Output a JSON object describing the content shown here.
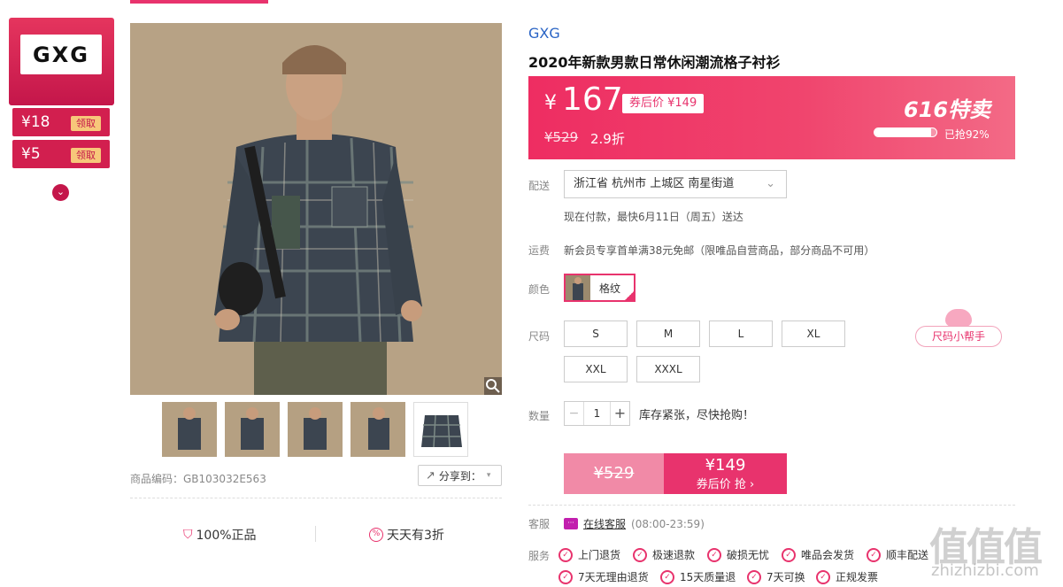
{
  "brand_panel": {
    "logo": "GXG",
    "coupons": [
      {
        "amount": "¥18",
        "action": "领取"
      },
      {
        "amount": "¥5",
        "action": "领取"
      }
    ],
    "expand_icon": "chevron-down-icon"
  },
  "product": {
    "brand": "GXG",
    "title": "2020年新款男款日常休闲潮流格子衬衫",
    "sku_code": "商品编码：GB103032E563",
    "share_label": "分享到："
  },
  "promises": [
    {
      "label": "100%正品",
      "icon": "shield-icon"
    },
    {
      "label": "天天有3折",
      "icon": "discount-icon"
    }
  ],
  "price": {
    "yen": "¥",
    "current": "167",
    "coupon_price": "券后价 ¥149",
    "original": "¥529",
    "discount": "2.9折",
    "sale_logo": "616特卖",
    "sold_percent": 92,
    "sold_text": "已抢92%"
  },
  "delivery": {
    "label": "配送",
    "address": "浙江省 杭州市 上城区 南星街道",
    "note": "现在付款，最快6月11日（周五）送达"
  },
  "shipping": {
    "label": "运费",
    "text": "新会员专享首单满38元免邮（限唯品自营商品，部分商品不可用）"
  },
  "color": {
    "label": "颜色",
    "selected": "格纹"
  },
  "size": {
    "label": "尺码",
    "options": [
      "S",
      "M",
      "L",
      "XL",
      "XXL",
      "XXXL"
    ],
    "helper": "尺码小帮手"
  },
  "quantity": {
    "label": "数量",
    "minus": "−",
    "value": "1",
    "plus": "+",
    "stock": "库存紧张，尽快抢购！"
  },
  "buy": {
    "original": "¥529",
    "price": "¥149",
    "label": "券后价 抢 ›"
  },
  "customer_service": {
    "label": "客服",
    "link": "在线客服",
    "hours": "(08:00-23:59)"
  },
  "services": {
    "label": "服务",
    "row1": [
      "上门退货",
      "极速退款",
      "破损无忧",
      "唯品会发货",
      "顺丰配送"
    ],
    "row2": [
      "7天无理由退货",
      "15天质量退",
      "7天可换",
      "正规发票"
    ]
  },
  "watermark": {
    "text": "值值值",
    "url": "zhizhizbi.com"
  },
  "colors": {
    "accent": "#e8336d",
    "brand_blue": "#2a64c5",
    "coupon_red": "#d21f4f"
  }
}
